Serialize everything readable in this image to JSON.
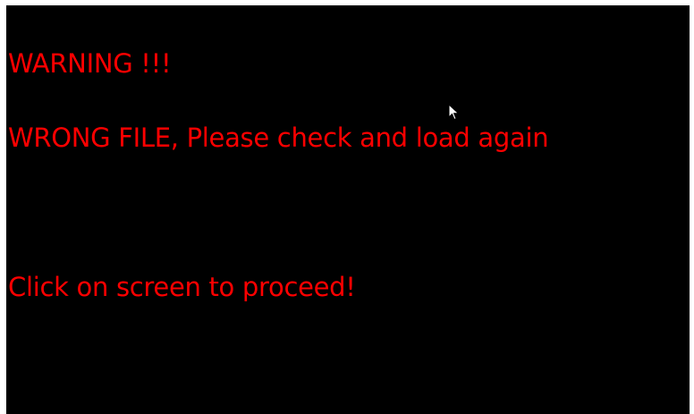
{
  "screen": {
    "background_color": "#000000",
    "text_color": "#ff0000",
    "warning_title": "WARNING !!!",
    "error_message": "WRONG FILE, Please check and load again",
    "proceed_prompt": "Click on screen to proceed!"
  },
  "cursor": {
    "icon": "mouse-pointer-icon"
  }
}
